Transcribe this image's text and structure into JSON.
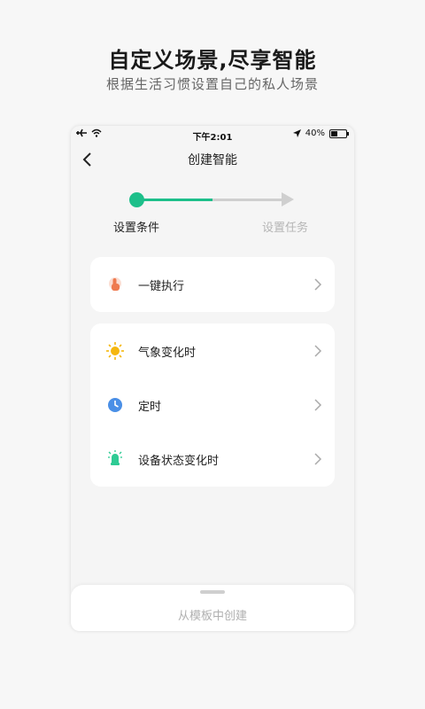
{
  "promo": {
    "title": "自定义场景,尽享智能",
    "subtitle": "根据生活习惯设置自己的私人场景"
  },
  "status_bar": {
    "time": "下午2:01",
    "battery": "40%"
  },
  "nav": {
    "title": "创建智能"
  },
  "stepper": {
    "steps": [
      "设置条件",
      "设置任务"
    ],
    "active_step": 1
  },
  "conditions": {
    "group1": [
      {
        "label": "一键执行",
        "icon": "tap-hand-icon"
      }
    ],
    "group2": [
      {
        "label": "气象变化时",
        "icon": "sun-icon"
      },
      {
        "label": "定时",
        "icon": "clock-icon"
      },
      {
        "label": "设备状态变化时",
        "icon": "device-bulb-icon"
      }
    ]
  },
  "bottom_sheet": {
    "label": "从模板中创建"
  },
  "colors": {
    "accent": "#1dbf8a",
    "inactive": "#cfcfcf",
    "tap_icon": "#ee7a4f",
    "sun_icon": "#f5b70f",
    "clock_icon": "#4a8fe6",
    "device_icon": "#2ecb94"
  }
}
